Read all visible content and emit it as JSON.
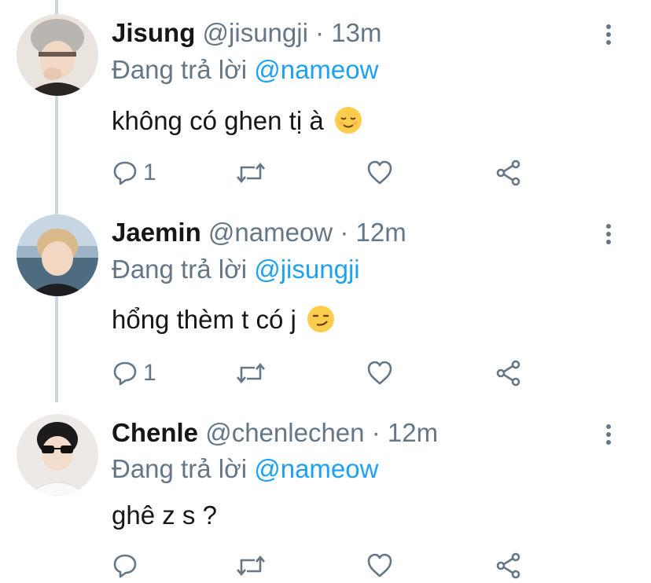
{
  "colors": {
    "link": "#1da1f2",
    "secondary_text": "#657786",
    "primary_text": "#14171a",
    "thread_line": "#ccd6dd"
  },
  "tweets": [
    {
      "name": "Jisung",
      "handle": "@jisungji",
      "separator": "·",
      "time": "13m",
      "reply_prefix": "Đang trả lời",
      "reply_to": "@nameow",
      "text": "không có ghen tị à",
      "emoji": "relieved-face-emoji",
      "reply_count": "1",
      "icons": [
        "reply-icon",
        "retweet-icon",
        "like-icon",
        "share-icon",
        "more-icon"
      ]
    },
    {
      "name": "Jaemin",
      "handle": "@nameow",
      "separator": "·",
      "time": "12m",
      "reply_prefix": "Đang trả lời",
      "reply_to": "@jisungji",
      "text": "hổng thèm t có j",
      "emoji": "smirking-face-emoji",
      "reply_count": "1",
      "icons": [
        "reply-icon",
        "retweet-icon",
        "like-icon",
        "share-icon",
        "more-icon"
      ]
    },
    {
      "name": "Chenle",
      "handle": "@chenlechen",
      "separator": "·",
      "time": "12m",
      "reply_prefix": "Đang trả lời",
      "reply_to": "@nameow",
      "text": "ghê z s ?",
      "emoji": "",
      "reply_count": "",
      "icons": [
        "reply-icon",
        "retweet-icon",
        "like-icon",
        "share-icon",
        "more-icon"
      ]
    }
  ]
}
